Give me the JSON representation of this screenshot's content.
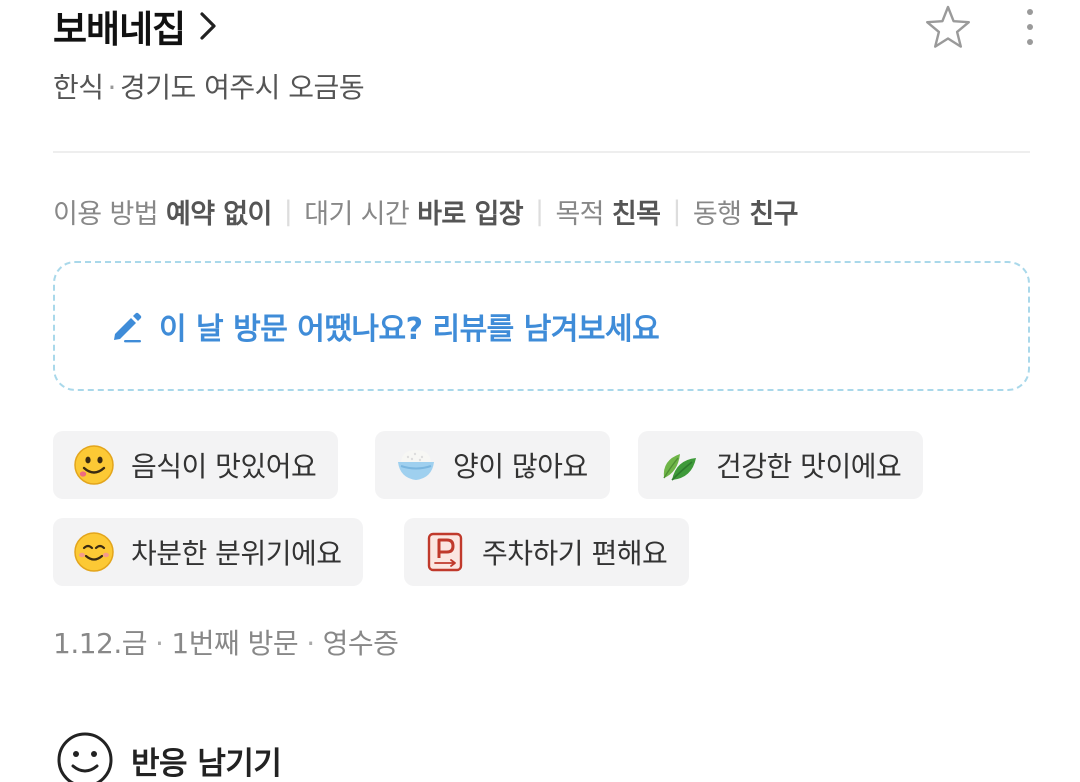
{
  "header": {
    "title": "보배네집",
    "icons": {
      "chevron": "chevron-right-icon",
      "favorite": "star-outline-icon",
      "more": "more-vertical-icon"
    }
  },
  "subtitle": {
    "category": "한식",
    "separator": "·",
    "location": "경기도 여주시 오금동"
  },
  "info": [
    {
      "label": "이용 방법",
      "value": "예약 없이"
    },
    {
      "label": "대기 시간",
      "value": "바로 입장"
    },
    {
      "label": "목적",
      "value": "친목"
    },
    {
      "label": "동행",
      "value": "친구"
    }
  ],
  "info_separator": "|",
  "review_prompt": {
    "text": "이 날 방문 어땠나요? 리뷰를 남겨보세요",
    "icon": "pencil-icon",
    "color": "#3f8cd8"
  },
  "keywords": [
    {
      "icon": "yummy-face-icon",
      "label": "음식이 맛있어요"
    },
    {
      "icon": "rice-bowl-icon",
      "label": "양이 많아요"
    },
    {
      "icon": "leaf-icon",
      "label": "건강한 맛이에요"
    },
    {
      "icon": "calm-face-icon",
      "label": "차분한 분위기에요"
    },
    {
      "icon": "parking-icon",
      "label": "주차하기 편해요"
    }
  ],
  "visit": {
    "date": "1.12.금",
    "count": "1번째 방문",
    "proof": "영수증",
    "separator": "·"
  },
  "reaction": {
    "label": "반응 남기기",
    "icon": "smile-icon"
  }
}
